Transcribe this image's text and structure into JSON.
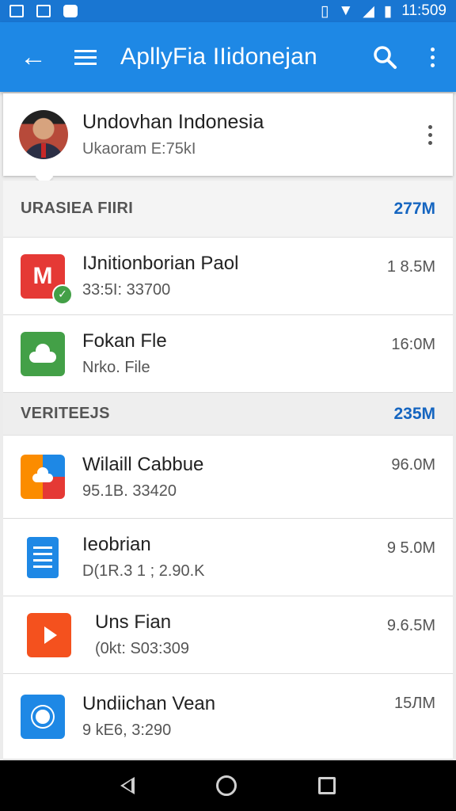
{
  "status_bar": {
    "time": "11:509",
    "icons": [
      "screenshot-icon",
      "gallery-icon",
      "app-icon",
      "vibrate-icon",
      "wifi-icon",
      "signal-icon",
      "battery-icon"
    ]
  },
  "app_bar": {
    "title": "ApllyFia IIidonejan",
    "color": "#1e88e5",
    "icons": [
      "back-arrow-icon",
      "hamburger-menu-icon",
      "search-icon",
      "more-vert-icon"
    ]
  },
  "profile": {
    "name": "Undovhan Indonesia",
    "subtitle": "Ukaoram E:75kI"
  },
  "sections": [
    {
      "label": "URASIEA FIIRI",
      "size": "277M",
      "items": [
        {
          "name": "IJnitionborian Paol",
          "meta": "33:5I: 33700",
          "size": "1 8.5M",
          "icon": "mail-icon",
          "badge": "check-icon"
        },
        {
          "name": "Fokan Fle",
          "meta": "Nrko. File",
          "size": "16:0M",
          "icon": "cloud-icon"
        }
      ]
    },
    {
      "label": "VERITEEJS",
      "size": "235M",
      "items": [
        {
          "name": "Wilaill Cabbue",
          "meta": "95.1B. 33420",
          "size": "96.0M",
          "icon": "weather-icon"
        },
        {
          "name": "Ieobrian",
          "meta": "D(1R.3 1 ; 2.90.K",
          "size": "9 5.0M",
          "icon": "document-icon"
        },
        {
          "name": "Uns Fian",
          "meta": "(0kt: S03:309",
          "size": "9.6.5M",
          "icon": "play-icon"
        },
        {
          "name": "Undiichan Vean",
          "meta": "9 kE6, 3:290",
          "size": "15ЛM",
          "icon": "brightness-icon"
        }
      ]
    }
  ],
  "nav_bar": {
    "icons": [
      "nav-back-icon",
      "nav-home-icon",
      "nav-recents-icon"
    ]
  }
}
